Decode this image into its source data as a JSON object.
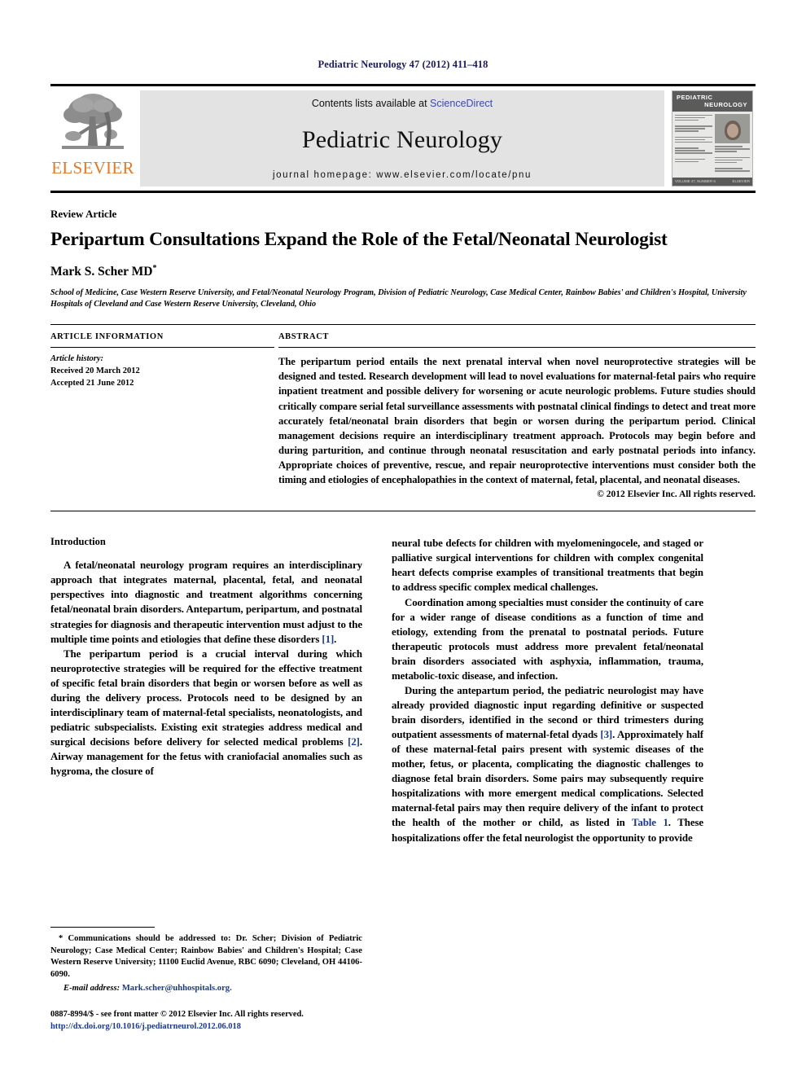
{
  "running_head": "Pediatric Neurology 47 (2012) 411–418",
  "masthead": {
    "publisher_name": "ELSEVIER",
    "contents_prefix": "Contents lists available at ",
    "contents_link": "ScienceDirect",
    "journal_title": "Pediatric Neurology",
    "homepage": "journal homepage: www.elsevier.com/locate/pnu",
    "cover": {
      "title_line1": "PEDIATRIC",
      "title_line2": "NEUROLOGY",
      "footer_left": "VOLUME 47, NUMBER 6",
      "footer_right": "ELSEVIER"
    }
  },
  "article": {
    "type": "Review Article",
    "title": "Peripartum Consultations Expand the Role of the Fetal/Neonatal Neurologist",
    "author": "Mark S. Scher MD",
    "author_marker": "*",
    "affiliation": "School of Medicine, Case Western Reserve University, and Fetal/Neonatal Neurology Program, Division of Pediatric Neurology, Case Medical Center, Rainbow Babies' and Children's Hospital, University Hospitals of Cleveland and Case Western Reserve University, Cleveland, Ohio"
  },
  "info": {
    "heading": "ARTICLE INFORMATION",
    "history_label": "Article history:",
    "received": "Received 20 March 2012",
    "accepted": "Accepted 21 June 2012"
  },
  "abstract": {
    "heading": "ABSTRACT",
    "text": "The peripartum period entails the next prenatal interval when novel neuroprotective strategies will be designed and tested. Research development will lead to novel evaluations for maternal-fetal pairs who require inpatient treatment and possible delivery for worsening or acute neurologic problems. Future studies should critically compare serial fetal surveillance assessments with postnatal clinical findings to detect and treat more accurately fetal/neonatal brain disorders that begin or worsen during the peripartum period. Clinical management decisions require an interdisciplinary treatment approach. Protocols may begin before and during parturition, and continue through neonatal resuscitation and early postnatal periods into infancy. Appropriate choices of preventive, rescue, and repair neuroprotective interventions must consider both the timing and etiologies of encephalopathies in the context of maternal, fetal, placental, and neonatal diseases.",
    "copyright": "© 2012 Elsevier Inc. All rights reserved."
  },
  "body": {
    "section_heading": "Introduction",
    "left_paragraphs": [
      {
        "before": "A fetal/neonatal neurology program requires an interdisciplinary approach that integrates maternal, placental, fetal, and neonatal perspectives into diagnostic and treatment algorithms concerning fetal/neonatal brain disorders. Antepartum, peripartum, and postnatal strategies for diagnosis and therapeutic intervention must adjust to the multiple time points and etiologies that define these disorders ",
        "cite": "[1]",
        "after": "."
      },
      {
        "before": "The peripartum period is a crucial interval during which neuroprotective strategies will be required for the effective treatment of specific fetal brain disorders that begin or worsen before as well as during the delivery process. Protocols need to be designed by an interdisciplinary team of maternal-fetal specialists, neonatologists, and pediatric subspecialists. Existing exit strategies address medical and surgical decisions before delivery for selected medical problems ",
        "cite": "[2]",
        "after": ". Airway management for the fetus with craniofacial anomalies such as hygroma, the closure of"
      }
    ],
    "right_paragraphs": [
      {
        "before": "neural tube defects for children with myelomeningocele, and staged or palliative surgical interventions for children with complex congenital heart defects comprise examples of transitional treatments that begin to address specific complex medical challenges.",
        "cite": "",
        "after": "",
        "indent": false
      },
      {
        "before": "Coordination among specialties must consider the continuity of care for a wider range of disease conditions as a function of time and etiology, extending from the prenatal to postnatal periods. Future therapeutic protocols must address more prevalent fetal/neonatal brain disorders associated with asphyxia, inflammation, trauma, metabolic-toxic disease, and infection.",
        "cite": "",
        "after": "",
        "indent": true
      },
      {
        "before": "During the antepartum period, the pediatric neurologist may have already provided diagnostic input regarding definitive or suspected brain disorders, identified in the second or third trimesters during outpatient assessments of maternal-fetal dyads ",
        "cite": "[3]",
        "after": ". Approximately half of these maternal-fetal pairs present with systemic diseases of the mother, fetus, or placenta, complicating the diagnostic challenges to diagnose fetal brain disorders. Some pairs may subsequently require hospitalizations with more emergent medical complications. Selected maternal-fetal pairs may then require delivery of the infant to protect the health of the mother or child, as listed in ",
        "cite2": "Table 1",
        "after2": ". These hospitalizations offer the fetal neurologist the opportunity to provide",
        "indent": true
      }
    ]
  },
  "footnote": {
    "marker": "*",
    "text": " Communications should be addressed to: Dr. Scher; Division of Pediatric Neurology; Case Medical Center; Rainbow Babies' and Children's Hospital; Case Western Reserve University; 11100 Euclid Avenue, RBC 6090; Cleveland, OH 44106-6090.",
    "email_label": "E-mail address:",
    "email": "Mark.scher@uhhospitals.org."
  },
  "imprint": {
    "line1": "0887-8994/$ - see front matter © 2012 Elsevier Inc. All rights reserved.",
    "doi": "http://dx.doi.org/10.1016/j.pediatrneurol.2012.06.018"
  },
  "colors": {
    "link": "#1a3a8f",
    "sciencedirect": "#3a49b5",
    "elsevier_orange": "#E87722",
    "running_head": "#1a1a5e"
  }
}
